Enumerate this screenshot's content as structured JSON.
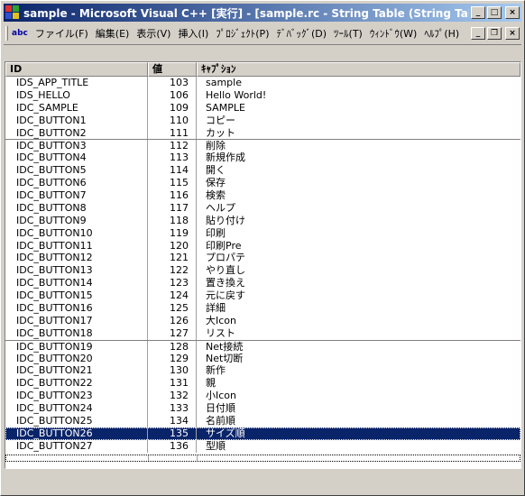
{
  "window": {
    "title": "sample - Microsoft Visual C++ [実行] - [sample.rc - String Table (String Table)]",
    "controls": {
      "minimize": "_",
      "maximize": "□",
      "close": "×"
    }
  },
  "menubar": {
    "icon_text": "abc",
    "items": [
      "ファイル(F)",
      "編集(E)",
      "表示(V)",
      "挿入(I)",
      "ﾌﾟﾛｼﾞｪｸﾄ(P)",
      "ﾃﾞﾊﾞｯｸﾞ(D)",
      "ﾂｰﾙ(T)",
      "ｳｨﾝﾄﾞｳ(W)",
      "ﾍﾙﾌﾟ(H)"
    ],
    "doc_controls": {
      "minimize": "_",
      "restore": "❐",
      "close": "×"
    }
  },
  "table": {
    "columns": [
      "ID",
      "値",
      "ｷｬﾌﾟｼｮﾝ"
    ],
    "rows": [
      {
        "id": "IDS_APP_TITLE",
        "value": "103",
        "caption": "sample"
      },
      {
        "id": "IDS_HELLO",
        "value": "106",
        "caption": "Hello World!"
      },
      {
        "id": "IDC_SAMPLE",
        "value": "109",
        "caption": "SAMPLE"
      },
      {
        "id": "IDC_BUTTON1",
        "value": "110",
        "caption": "コピー"
      },
      {
        "id": "IDC_BUTTON2",
        "value": "111",
        "caption": "カット"
      },
      {
        "id": "IDC_BUTTON3",
        "value": "112",
        "caption": "削除",
        "sep": true
      },
      {
        "id": "IDC_BUTTON4",
        "value": "113",
        "caption": "新規作成"
      },
      {
        "id": "IDC_BUTTON5",
        "value": "114",
        "caption": "開く"
      },
      {
        "id": "IDC_BUTTON6",
        "value": "115",
        "caption": "保存"
      },
      {
        "id": "IDC_BUTTON7",
        "value": "116",
        "caption": "検索"
      },
      {
        "id": "IDC_BUTTON8",
        "value": "117",
        "caption": "ヘルプ"
      },
      {
        "id": "IDC_BUTTON9",
        "value": "118",
        "caption": "貼り付け"
      },
      {
        "id": "IDC_BUTTON10",
        "value": "119",
        "caption": "印刷"
      },
      {
        "id": "IDC_BUTTON11",
        "value": "120",
        "caption": "印刷Pre"
      },
      {
        "id": "IDC_BUTTON12",
        "value": "121",
        "caption": "プロパテ"
      },
      {
        "id": "IDC_BUTTON13",
        "value": "122",
        "caption": "やり直し"
      },
      {
        "id": "IDC_BUTTON14",
        "value": "123",
        "caption": "置き換え"
      },
      {
        "id": "IDC_BUTTON15",
        "value": "124",
        "caption": "元に戻す"
      },
      {
        "id": "IDC_BUTTON16",
        "value": "125",
        "caption": "詳細"
      },
      {
        "id": "IDC_BUTTON17",
        "value": "126",
        "caption": "大Icon"
      },
      {
        "id": "IDC_BUTTON18",
        "value": "127",
        "caption": "リスト"
      },
      {
        "id": "IDC_BUTTON19",
        "value": "128",
        "caption": "Net接続",
        "sep": true
      },
      {
        "id": "IDC_BUTTON20",
        "value": "129",
        "caption": "Net切断"
      },
      {
        "id": "IDC_BUTTON21",
        "value": "130",
        "caption": "新作"
      },
      {
        "id": "IDC_BUTTON22",
        "value": "131",
        "caption": "親"
      },
      {
        "id": "IDC_BUTTON23",
        "value": "132",
        "caption": "小Icon"
      },
      {
        "id": "IDC_BUTTON24",
        "value": "133",
        "caption": "日付順"
      },
      {
        "id": "IDC_BUTTON25",
        "value": "134",
        "caption": "名前順"
      },
      {
        "id": "IDC_BUTTON26",
        "value": "135",
        "caption": "サイズ順",
        "selected": true
      },
      {
        "id": "IDC_BUTTON27",
        "value": "136",
        "caption": "型順"
      }
    ]
  },
  "colors": {
    "title_gradient_start": "#0a246a",
    "title_gradient_end": "#a6caf0",
    "selection": "#0a246a",
    "face": "#d4d0c8"
  }
}
